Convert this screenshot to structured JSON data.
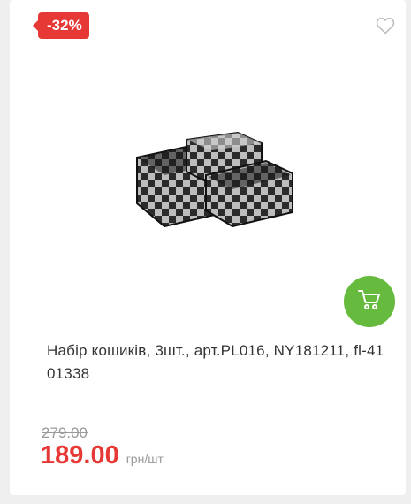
{
  "product": {
    "discount_badge": "-32%",
    "title": "Набір кошиків, 3шт., арт.PL016, NY181211, fl-41 01338",
    "old_price": "279.00",
    "price": "189.00",
    "unit": "грн/шт"
  },
  "icons": {
    "favorite": "heart-outline-icon",
    "cart": "shopping-cart-icon"
  },
  "colors": {
    "discount": "#e63835",
    "cart_button": "#66bb3f"
  }
}
